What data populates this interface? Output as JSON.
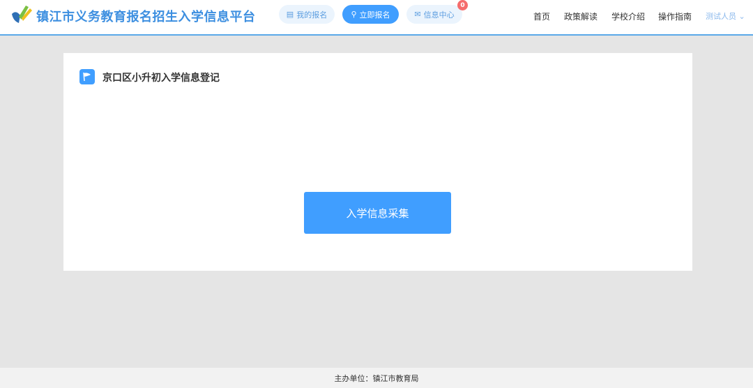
{
  "header": {
    "title": "镇江市义务教育报名招生入学信息平台",
    "my_registration": "我的报名",
    "register_now": "立即报名",
    "messages": "信息中心",
    "message_count": "0",
    "nav": [
      "首页",
      "政策解读",
      "学校介绍",
      "操作指南"
    ],
    "user": "测试人员"
  },
  "card": {
    "title": "京口区小升初入学信息登记",
    "button": "入学信息采集"
  },
  "footer": {
    "text": "主办单位：镇江市教育局"
  }
}
